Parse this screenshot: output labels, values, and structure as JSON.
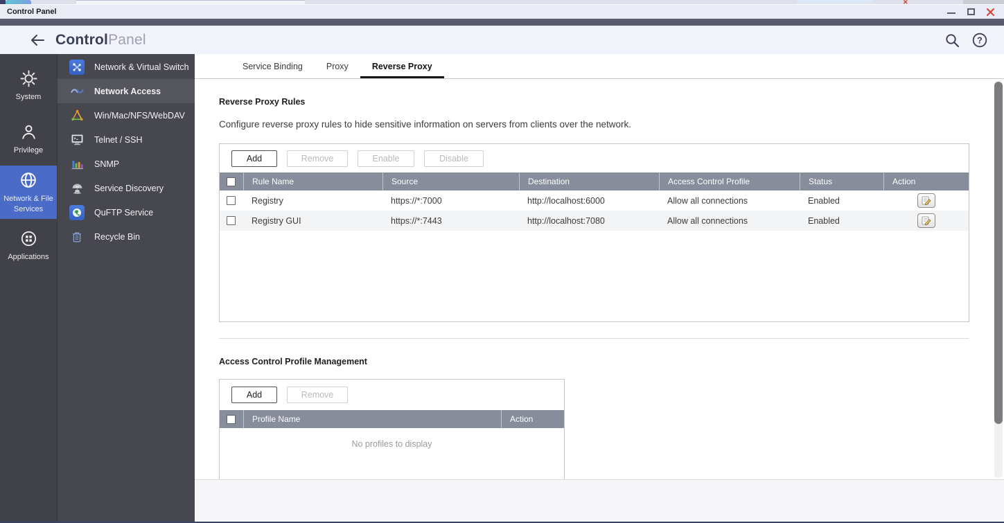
{
  "window": {
    "title": "Control Panel"
  },
  "header": {
    "brand_bold": "Control",
    "brand_light": "Panel"
  },
  "icons": {
    "help_glyph": "?"
  },
  "nav_primary": {
    "items": [
      {
        "label": "System"
      },
      {
        "label": "Privilege"
      },
      {
        "label": "Network & File Services"
      },
      {
        "label": "Applications"
      }
    ]
  },
  "nav_secondary": {
    "items": [
      {
        "label": "Network & Virtual Switch"
      },
      {
        "label": "Network Access"
      },
      {
        "label": "Win/Mac/NFS/WebDAV"
      },
      {
        "label": "Telnet / SSH"
      },
      {
        "label": "SNMP"
      },
      {
        "label": "Service Discovery"
      },
      {
        "label": "QuFTP Service"
      },
      {
        "label": "Recycle Bin"
      }
    ]
  },
  "tabs": [
    {
      "label": "Service Binding"
    },
    {
      "label": "Proxy"
    },
    {
      "label": "Reverse Proxy"
    }
  ],
  "rules_section": {
    "title": "Reverse Proxy Rules",
    "description": "Configure reverse proxy rules to hide sensitive information on servers from clients over the network.",
    "toolbar": {
      "add": "Add",
      "remove": "Remove",
      "enable": "Enable",
      "disable": "Disable"
    },
    "columns": [
      "Rule Name",
      "Source",
      "Destination",
      "Access Control Profile",
      "Status",
      "Action"
    ],
    "rows": [
      {
        "name": "Registry",
        "source": "https://*:7000",
        "destination": "http://localhost:6000",
        "profile": "Allow all connections",
        "status": "Enabled"
      },
      {
        "name": "Registry GUI",
        "source": "https://*:7443",
        "destination": "http://localhost:7080",
        "profile": "Allow all connections",
        "status": "Enabled"
      }
    ]
  },
  "profiles_section": {
    "title": "Access Control Profile Management",
    "toolbar": {
      "add": "Add",
      "remove": "Remove"
    },
    "columns": [
      "Profile Name",
      "Action"
    ],
    "empty_text": "No profiles to display"
  },
  "colors": {
    "accent_blue": "#4a6cc8",
    "header_strip": "#575b6d",
    "table_header_bg": "#878d9a",
    "close_red": "#d24a3e"
  }
}
